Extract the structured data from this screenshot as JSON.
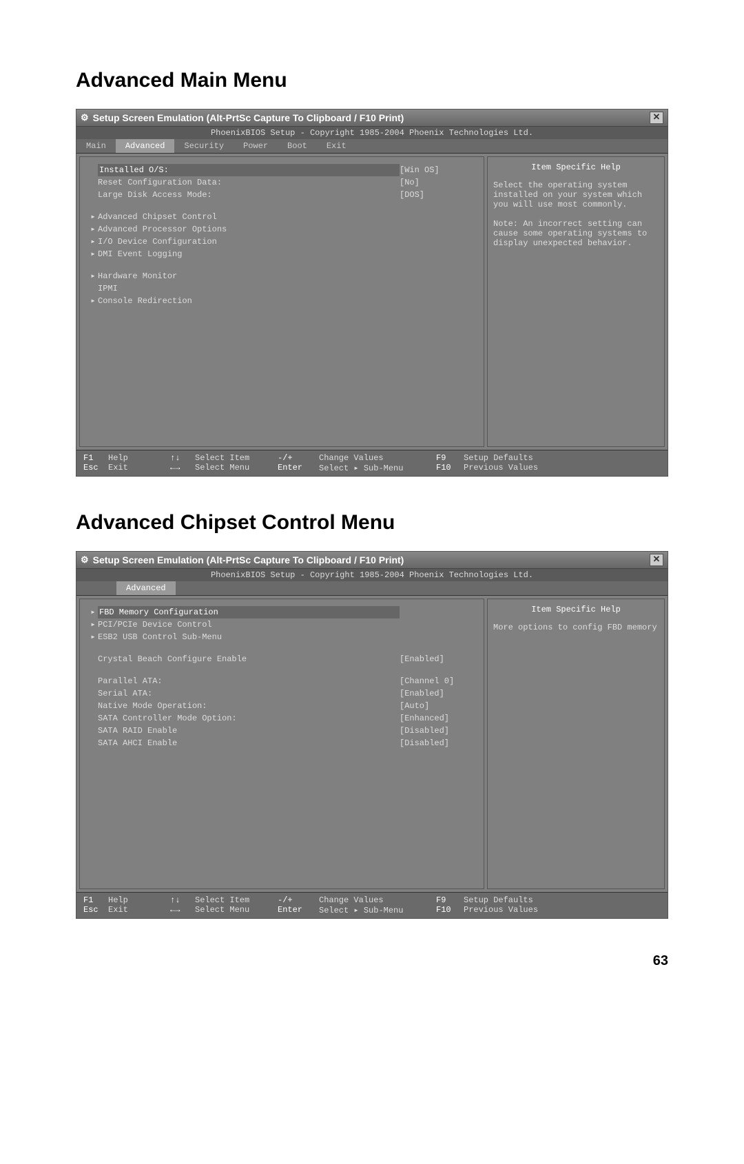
{
  "page_number": "63",
  "section1": {
    "heading": "Advanced Main Menu",
    "window_title": "Setup Screen Emulation (Alt-PrtSc Capture To Clipboard / F10 Print)",
    "copyright": "PhoenixBIOS Setup - Copyright 1985-2004 Phoenix Technologies Ltd.",
    "tabs": [
      "Main",
      "Advanced",
      "Security",
      "Power",
      "Boot",
      "Exit"
    ],
    "active_tab": "Advanced",
    "items": [
      {
        "arrow": "",
        "label": "Installed O/S:",
        "value": "[Win OS]",
        "sel": true
      },
      {
        "arrow": "",
        "label": "Reset Configuration Data:",
        "value": "[No]"
      },
      {
        "arrow": "",
        "label": "Large Disk Access Mode:",
        "value": "[DOS]"
      },
      {
        "spacer": true
      },
      {
        "arrow": "▸",
        "label": "Advanced Chipset Control",
        "value": ""
      },
      {
        "arrow": "▸",
        "label": "Advanced Processor Options",
        "value": ""
      },
      {
        "arrow": "▸",
        "label": "I/O Device Configuration",
        "value": ""
      },
      {
        "arrow": "▸",
        "label": "DMI Event Logging",
        "value": ""
      },
      {
        "spacer": true
      },
      {
        "arrow": "▸",
        "label": "Hardware Monitor",
        "value": ""
      },
      {
        "arrow": "",
        "label": "IPMI",
        "value": ""
      },
      {
        "arrow": "▸",
        "label": "Console Redirection",
        "value": ""
      }
    ],
    "help_title": "Item Specific Help",
    "help_text": "Select the operating system installed on your system which you will use most commonly.\n\nNote: An incorrect setting can cause some operating systems to display unexpected behavior."
  },
  "section2": {
    "heading": "Advanced Chipset Control Menu",
    "window_title": "Setup Screen Emulation (Alt-PrtSc Capture To Clipboard / F10 Print)",
    "copyright": "PhoenixBIOS Setup - Copyright 1985-2004 Phoenix Technologies Ltd.",
    "tabs": [
      "Advanced"
    ],
    "active_tab": "Advanced",
    "items": [
      {
        "arrow": "▸",
        "label": "FBD Memory Configuration",
        "value": "",
        "sel": true
      },
      {
        "arrow": "▸",
        "label": "PCI/PCIe Device Control",
        "value": ""
      },
      {
        "arrow": "▸",
        "label": "ESB2 USB Control Sub-Menu",
        "value": ""
      },
      {
        "spacer": true
      },
      {
        "arrow": "",
        "label": "Crystal Beach Configure Enable",
        "value": "[Enabled]"
      },
      {
        "spacer": true
      },
      {
        "arrow": "",
        "label": "Parallel ATA:",
        "value": "[Channel 0]"
      },
      {
        "arrow": "",
        "label": "Serial ATA:",
        "value": "[Enabled]"
      },
      {
        "arrow": "",
        "label": "Native Mode Operation:",
        "value": "[Auto]"
      },
      {
        "arrow": "",
        "label": "SATA Controller Mode Option:",
        "value": "[Enhanced]"
      },
      {
        "arrow": "",
        "label": "SATA RAID Enable",
        "value": "[Disabled]"
      },
      {
        "arrow": "",
        "label": "SATA AHCI Enable",
        "value": "[Disabled]"
      }
    ],
    "help_title": "Item Specific Help",
    "help_text": "More options to config FBD memory"
  },
  "footer": {
    "r1": {
      "k1": "F1",
      "l1": "Help",
      "k2": "↑↓",
      "l2": "Select Item",
      "k3": "-/+",
      "l3": "Change Values",
      "k4": "F9",
      "l4": "Setup Defaults"
    },
    "r2": {
      "k1": "Esc",
      "l1": "Exit",
      "k2": "←→",
      "l2": "Select Menu",
      "k3": "Enter",
      "l3": "Select ▸ Sub-Menu",
      "k4": "F10",
      "l4": "Previous Values"
    }
  }
}
